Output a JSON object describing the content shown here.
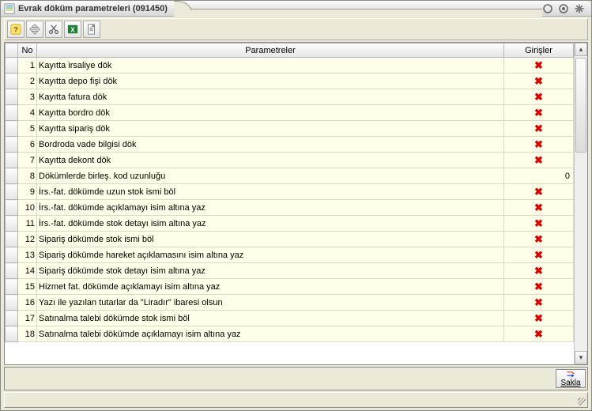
{
  "window": {
    "title": "Evrak döküm parametreleri (091450)"
  },
  "toolbar": {
    "help_icon": "help-icon",
    "note_icon": "note-icon",
    "scissors_icon": "scissors-icon",
    "excel_icon": "excel-icon",
    "doc_icon": "document-icon"
  },
  "grid": {
    "columns": {
      "sel": "",
      "no": "No",
      "param": "Parametreler",
      "giris": "Girişler"
    },
    "rows": [
      {
        "no": "1",
        "param": "Kayıtta irsaliye dök",
        "giris_type": "x"
      },
      {
        "no": "2",
        "param": "Kayıtta depo fişi dök",
        "giris_type": "x"
      },
      {
        "no": "3",
        "param": "Kayıtta fatura dök",
        "giris_type": "x"
      },
      {
        "no": "4",
        "param": "Kayıtta bordro dök",
        "giris_type": "x"
      },
      {
        "no": "5",
        "param": "Kayıtta sipariş dök",
        "giris_type": "x"
      },
      {
        "no": "6",
        "param": "Bordroda vade bilgisi dök",
        "giris_type": "x"
      },
      {
        "no": "7",
        "param": "Kayıtta dekont dök",
        "giris_type": "x"
      },
      {
        "no": "8",
        "param": "Dökümlerde birleş. kod uzunluğu",
        "giris_type": "text",
        "giris_text": "0"
      },
      {
        "no": "9",
        "param": "İrs.-fat. dökümde uzun stok ismi böl",
        "giris_type": "x"
      },
      {
        "no": "10",
        "param": "İrs.-fat. dökümde açıklamayı isim altına yaz",
        "giris_type": "x"
      },
      {
        "no": "11",
        "param": "İrs.-fat. dökümde stok detayı isim altına yaz",
        "giris_type": "x"
      },
      {
        "no": "12",
        "param": "Sipariş dökümde stok ismi böl",
        "giris_type": "x"
      },
      {
        "no": "13",
        "param": "Sipariş dökümde hareket açıklamasını isim altına yaz",
        "giris_type": "x"
      },
      {
        "no": "14",
        "param": "Sipariş dökümde stok detayı isim altına yaz",
        "giris_type": "x"
      },
      {
        "no": "15",
        "param": "Hizmet fat. dökümde açıklamayı isim altına yaz",
        "giris_type": "x"
      },
      {
        "no": "16",
        "param": "Yazı ile yazılan tutarlar da \"Liradır\" ibaresi olsun",
        "giris_type": "x"
      },
      {
        "no": "17",
        "param": "Satınalma talebi dökümde stok ismi böl",
        "giris_type": "x"
      },
      {
        "no": "18",
        "param": "Satınalma talebi dökümde açıklamayı isim altına yaz",
        "giris_type": "x"
      }
    ]
  },
  "buttons": {
    "save_label": "Sakla"
  }
}
